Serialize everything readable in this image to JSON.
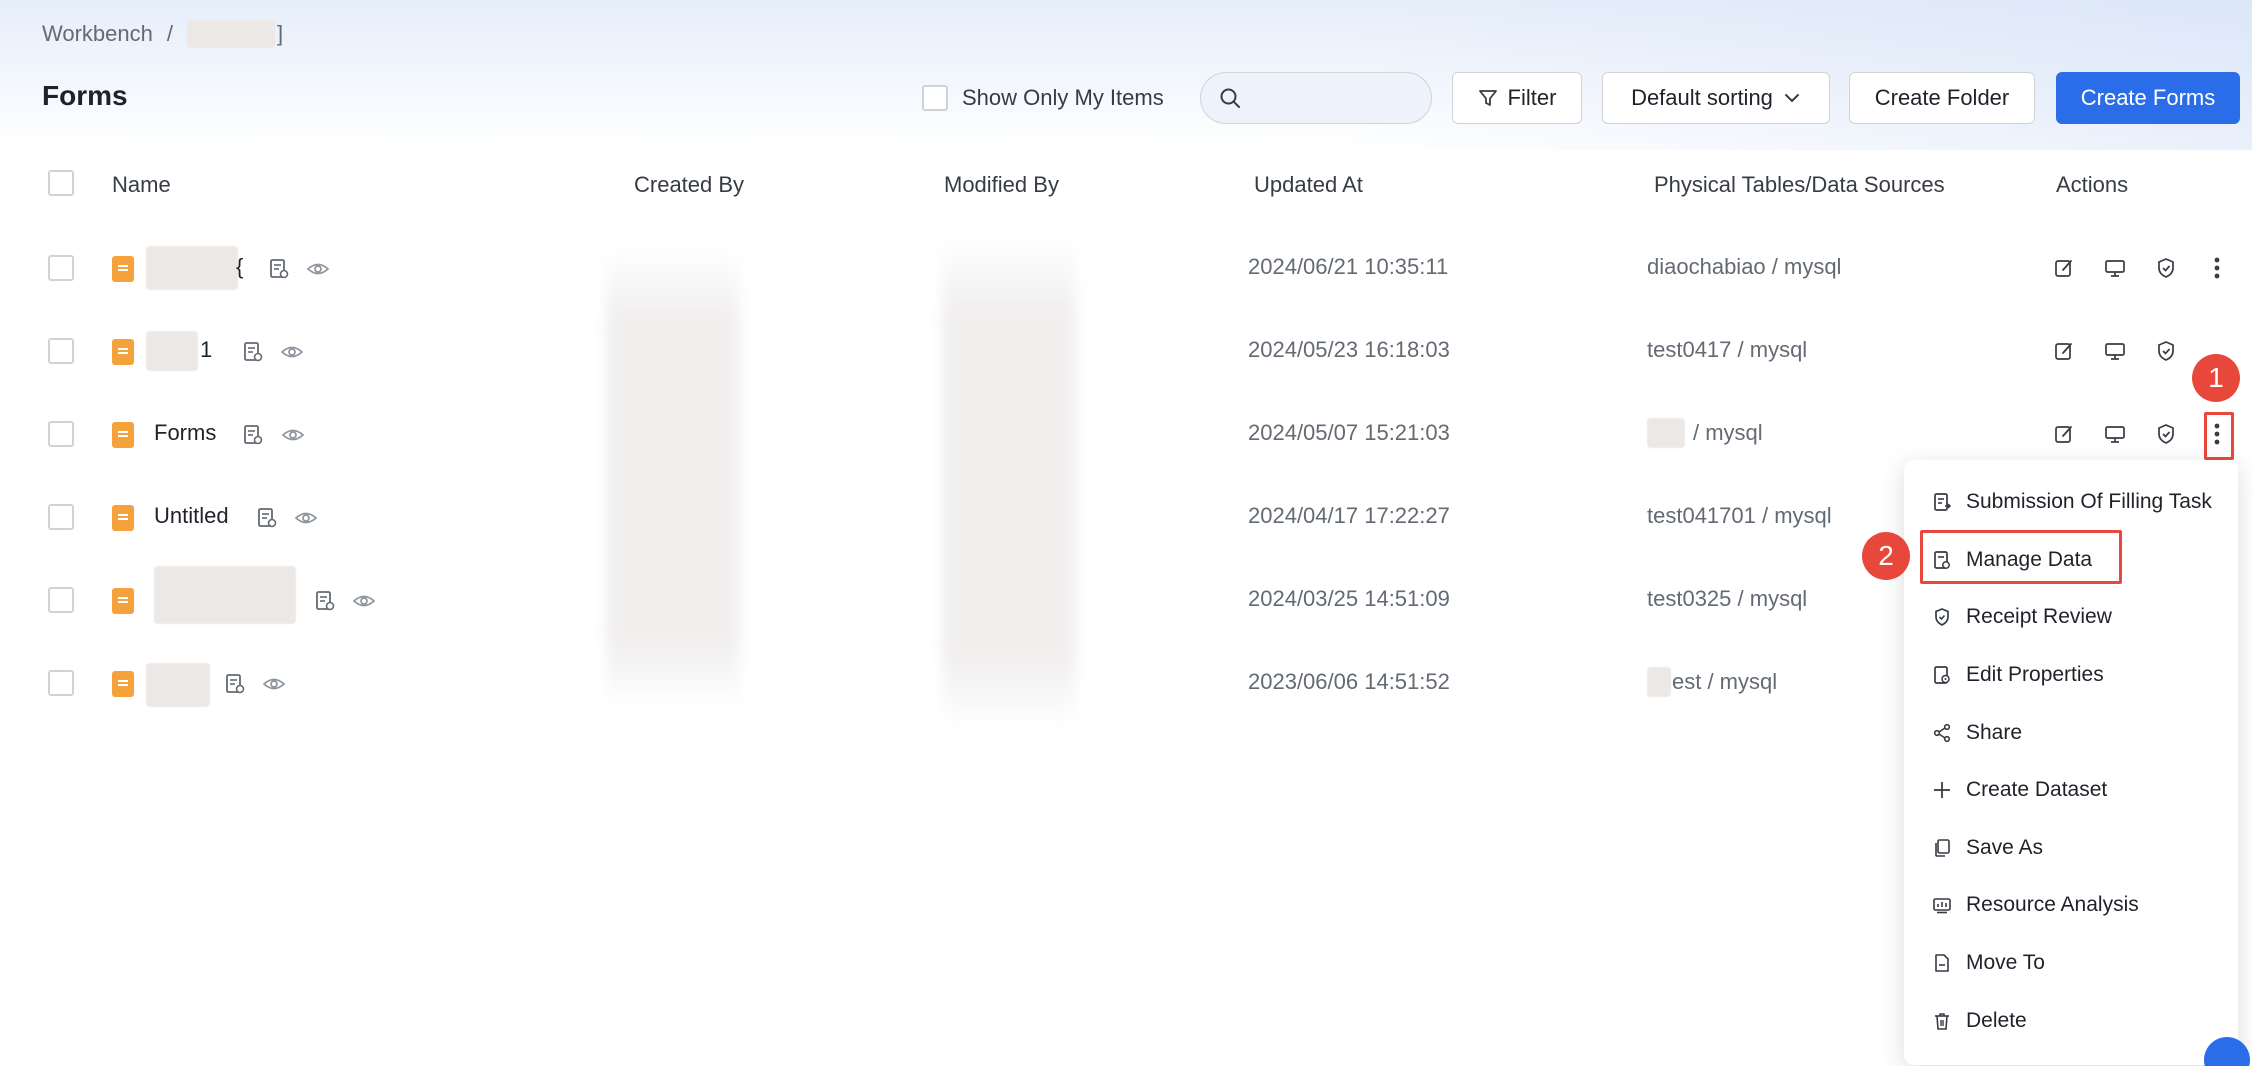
{
  "breadcrumb": {
    "root": "Workbench",
    "separator": "/",
    "tail": "]"
  },
  "page": {
    "title": "Forms"
  },
  "toolbar": {
    "show_only_mine": "Show Only My Items",
    "search_placeholder": "",
    "filter": "Filter",
    "sorting": "Default sorting",
    "create_folder": "Create Folder",
    "create_forms": "Create Forms"
  },
  "table": {
    "headers": {
      "name": "Name",
      "created_by": "Created By",
      "modified_by": "Modified By",
      "updated_at": "Updated At",
      "sources": "Physical Tables/Data Sources",
      "actions": "Actions"
    },
    "rows": [
      {
        "name": "{",
        "updated_at": "2024/06/21 10:35:11",
        "source": "diaochabiao / mysql"
      },
      {
        "name": "1",
        "updated_at": "2024/05/23 16:18:03",
        "source": "test0417 / mysql"
      },
      {
        "name": "Forms",
        "updated_at": "2024/05/07 15:21:03",
        "source": "/ mysql"
      },
      {
        "name": "Untitled",
        "updated_at": "2024/04/17 17:22:27",
        "source": "test041701 / mysql"
      },
      {
        "name": "",
        "updated_at": "2024/03/25 14:51:09",
        "source": "test0325 / mysql"
      },
      {
        "name": "",
        "updated_at": "2023/06/06 14:51:52",
        "source": "est / mysql"
      }
    ]
  },
  "menu": {
    "items": [
      {
        "label": "Submission Of Filling Task",
        "icon": "task-submit-icon"
      },
      {
        "label": "Manage Data",
        "icon": "manage-data-icon"
      },
      {
        "label": "Receipt Review",
        "icon": "shield-check-icon"
      },
      {
        "label": "Edit Properties",
        "icon": "edit-properties-icon"
      },
      {
        "label": "Share",
        "icon": "share-icon"
      },
      {
        "label": "Create Dataset",
        "icon": "plus-icon"
      },
      {
        "label": "Save As",
        "icon": "copy-icon"
      },
      {
        "label": "Resource Analysis",
        "icon": "analysis-icon"
      },
      {
        "label": "Move To",
        "icon": "move-icon"
      },
      {
        "label": "Delete",
        "icon": "trash-icon"
      }
    ]
  },
  "annotations": {
    "step1": "1",
    "step2": "2"
  },
  "colors": {
    "primary": "#2b6de9",
    "file_icon": "#f5a23c",
    "annotation": "#e8483b"
  }
}
